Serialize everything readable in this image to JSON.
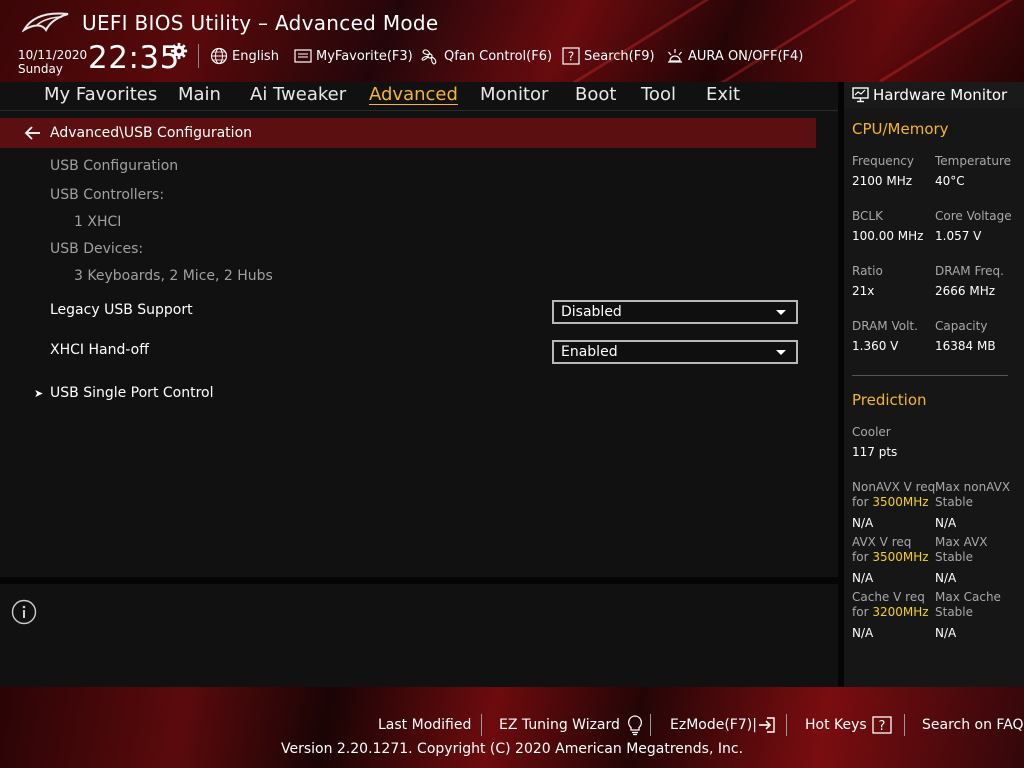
{
  "header": {
    "title": "UEFI BIOS Utility – Advanced Mode",
    "date": "10/11/2020",
    "day": "Sunday",
    "time": "22:35",
    "items": [
      {
        "label": "English",
        "icon": "globe-icon"
      },
      {
        "label": "MyFavorite(F3)",
        "icon": "favorite-icon"
      },
      {
        "label": "Qfan Control(F6)",
        "icon": "fan-icon"
      },
      {
        "label": "Search(F9)",
        "icon": "search-help-icon"
      },
      {
        "label": "AURA ON/OFF(F4)",
        "icon": "aura-icon"
      }
    ]
  },
  "tabs": [
    {
      "label": "My Favorites"
    },
    {
      "label": "Main"
    },
    {
      "label": "Ai Tweaker"
    },
    {
      "label": "Advanced",
      "active": true
    },
    {
      "label": "Monitor"
    },
    {
      "label": "Boot"
    },
    {
      "label": "Tool"
    },
    {
      "label": "Exit"
    }
  ],
  "main": {
    "breadcrumb": "Advanced\\USB Configuration",
    "usb_configuration": "USB Configuration",
    "usb_controllers_label": "USB Controllers:",
    "usb_controllers_value": "1 XHCI",
    "usb_devices_label": "USB Devices:",
    "usb_devices_value": "3 Keyboards, 2 Mice, 2 Hubs",
    "settings": [
      {
        "label": "Legacy USB Support",
        "value": "Disabled"
      },
      {
        "label": "XHCI Hand-off",
        "value": "Enabled"
      }
    ],
    "submenu": "USB Single Port Control"
  },
  "hw_monitor": {
    "title": "Hardware Monitor",
    "cpu_memory": {
      "title": "CPU/Memory",
      "fields": [
        {
          "label": "Frequency",
          "value": "2100 MHz"
        },
        {
          "label": "Temperature",
          "value": "40°C"
        },
        {
          "label": "BCLK",
          "value": "100.00 MHz"
        },
        {
          "label": "Core Voltage",
          "value": "1.057 V"
        },
        {
          "label": "Ratio",
          "value": "21x"
        },
        {
          "label": "DRAM Freq.",
          "value": "2666 MHz"
        },
        {
          "label": "DRAM Volt.",
          "value": "1.360 V"
        },
        {
          "label": "Capacity",
          "value": "16384 MB"
        }
      ]
    },
    "prediction": {
      "title": "Prediction",
      "cooler_label": "Cooler",
      "cooler_value": "117 pts",
      "nonavx_req_label": "NonAVX V req",
      "nonavx_req_for": "for",
      "nonavx_req_freq": "3500MHz",
      "nonavx_req_value": "N/A",
      "max_nonavx_label1": "Max nonAVX",
      "max_nonavx_label2": "Stable",
      "max_nonavx_value": "N/A",
      "avx_req_label": "AVX V req",
      "avx_req_for": "for",
      "avx_req_freq": "3500MHz",
      "avx_req_value": "N/A",
      "max_avx_label1": "Max AVX",
      "max_avx_label2": "Stable",
      "max_avx_value": "N/A",
      "cache_req_label": "Cache V req",
      "cache_req_for": "for",
      "cache_req_freq": "3200MHz",
      "cache_req_value": "N/A",
      "max_cache_label1": "Max Cache",
      "max_cache_label2": "Stable",
      "max_cache_value": "N/A"
    }
  },
  "footer": {
    "last_modified": "Last Modified",
    "ez_tuning": "EZ Tuning Wizard",
    "ez_mode": "EzMode(F7)|",
    "hot_keys": "Hot Keys",
    "search_faq": "Search on FAQ",
    "copyright": "Version 2.20.1271. Copyright (C) 2020 American Megatrends, Inc."
  },
  "colors": {
    "accent": "#f3b62a",
    "highlight": "#f3d21a",
    "breadcrumb_bg": "#5b0f10"
  }
}
